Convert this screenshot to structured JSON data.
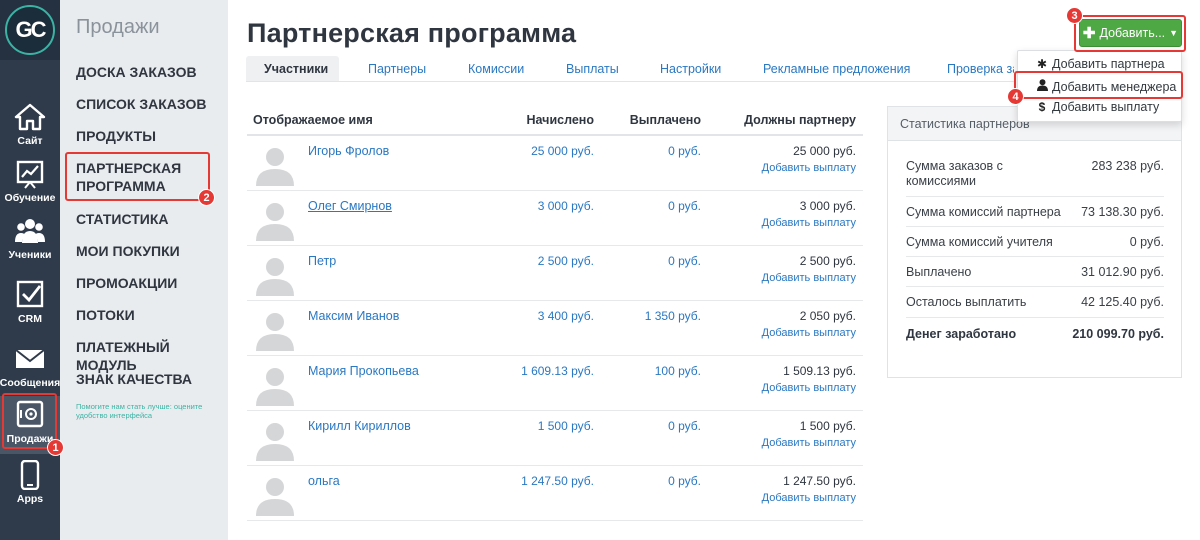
{
  "logo": {
    "text": "GC"
  },
  "rail": [
    {
      "label": "Сайт",
      "icon": "home-icon"
    },
    {
      "label": "Обучение",
      "icon": "chart-board-icon"
    },
    {
      "label": "Ученики",
      "icon": "users-icon"
    },
    {
      "label": "CRM",
      "icon": "checkbox-icon"
    },
    {
      "label": "Сообщения",
      "icon": "envelope-icon"
    },
    {
      "label": "Продажи",
      "icon": "safe-icon",
      "active": true
    },
    {
      "label": "Apps",
      "icon": "phone-icon"
    }
  ],
  "submenu": {
    "title": "Продажи",
    "items": [
      "ДОСКА ЗАКАЗОВ",
      "СПИСОК ЗАКАЗОВ",
      "ПРОДУКТЫ",
      "ПАРТНЕРСКАЯ ПРОГРАММА",
      "СТАТИСТИКА",
      "МОИ ПОКУПКИ",
      "ПРОМОАКЦИИ",
      "ПОТОКИ",
      "ПЛАТЕЖНЫЙ МОДУЛЬ",
      "ЗНАК КАЧЕСТВА"
    ],
    "note": "Помогите нам стать лучше: оцените удобство интерфейса"
  },
  "page": {
    "title": "Партнерская программа"
  },
  "tabs": [
    "Участники",
    "Партнеры",
    "Комиссии",
    "Выплаты",
    "Настройки",
    "Рекламные предложения",
    "Проверка за"
  ],
  "add_button": {
    "label": "Добавить..."
  },
  "dropdown": [
    {
      "label": "Добавить партнера",
      "icon": "asterisk-icon"
    },
    {
      "label": "Добавить менеджера",
      "icon": "user-icon"
    },
    {
      "label": "Добавить выплату",
      "icon": "dollar-icon"
    }
  ],
  "table": {
    "headers": {
      "name": "Отображаемое имя",
      "accrued": "Начислено",
      "paid": "Выплачено",
      "owed": "Должны партнеру"
    },
    "add_payment_label": "Добавить выплату",
    "rows": [
      {
        "name": "Игорь Фролов",
        "accrued": "25 000 руб.",
        "paid": "0 руб.",
        "owed": "25 000 руб."
      },
      {
        "name": "Олег Смирнов",
        "accrued": "3 000 руб.",
        "paid": "0 руб.",
        "owed": "3 000 руб.",
        "underline": true
      },
      {
        "name": "Петр",
        "accrued": "2 500 руб.",
        "paid": "0 руб.",
        "owed": "2 500 руб."
      },
      {
        "name": "Максим Иванов",
        "accrued": "3 400 руб.",
        "paid": "1 350 руб.",
        "owed": "2 050 руб."
      },
      {
        "name": "Мария Прокопьева",
        "accrued": "1 609.13 руб.",
        "paid": "100 руб.",
        "owed": "1 509.13 руб."
      },
      {
        "name": "Кирилл Кириллов",
        "accrued": "1 500 руб.",
        "paid": "0 руб.",
        "owed": "1 500 руб."
      },
      {
        "name": "ольга",
        "accrued": "1 247.50 руб.",
        "paid": "0 руб.",
        "owed": "1 247.50 руб."
      }
    ]
  },
  "stats": {
    "title": "Статистика партнеров",
    "rows": [
      {
        "label": "Сумма заказов с комиссиями",
        "value": "283 238 руб."
      },
      {
        "label": "Сумма комиссий партнера",
        "value": "73 138.30 руб."
      },
      {
        "label": "Сумма комиссий учителя",
        "value": "0 руб."
      },
      {
        "label": "Выплачено",
        "value": "31 012.90 руб."
      },
      {
        "label": "Осталось выплатить",
        "value": "42 125.40 руб."
      },
      {
        "label": "Денег заработано",
        "value": "210 099.70 руб.",
        "total": true
      }
    ]
  },
  "annotations": [
    "1",
    "2",
    "3",
    "4"
  ],
  "colors": {
    "accent": "#2a78c2",
    "add_button": "#4ea843",
    "rail": "#2f3b4a",
    "highlight": "#e53935"
  }
}
